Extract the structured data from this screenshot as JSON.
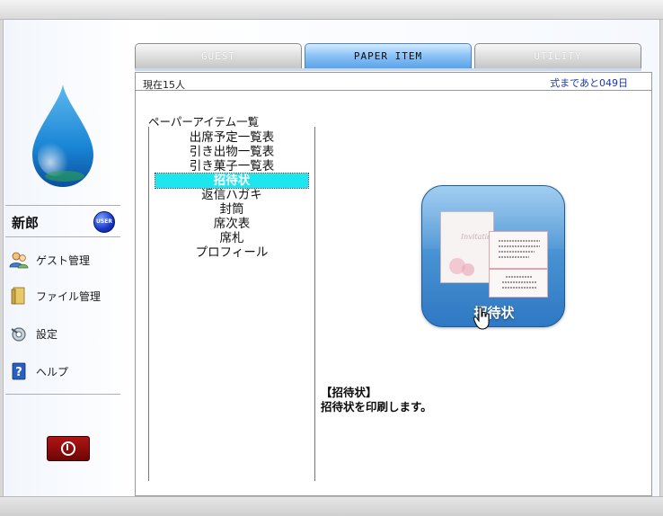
{
  "tabs": [
    {
      "label": "GUEST",
      "active": false
    },
    {
      "label": "PAPER ITEM",
      "active": true
    },
    {
      "label": "UTILITY",
      "active": false
    }
  ],
  "sidebar": {
    "user_name": "新郎",
    "user_badge": "USER",
    "items": [
      {
        "label": "ゲスト管理",
        "icon": "users-icon"
      },
      {
        "label": "ファイル管理",
        "icon": "folder-icon"
      },
      {
        "label": "設定",
        "icon": "settings-icon"
      },
      {
        "label": "ヘルプ",
        "icon": "help-icon"
      }
    ],
    "power_icon": "power-icon"
  },
  "status": {
    "left": "現在15人",
    "right": "式まであと049日"
  },
  "paper_list": {
    "title": "ペーパーアイテム一覧",
    "items": [
      "出席予定一覧表",
      "引き出物一覧表",
      "引き菓子一覧表",
      "招待状",
      "返信ハガキ",
      "封筒",
      "席次表",
      "席札",
      "プロフィール"
    ],
    "selected": "招待状"
  },
  "preview": {
    "label": "招待状",
    "card_script": "Invitation"
  },
  "description": {
    "heading": "【招待状】",
    "body": "招待状を印刷します。"
  },
  "colors": {
    "accent": "#4791d2",
    "selection": "#1ee6ef",
    "status_right": "#1a36b4"
  }
}
